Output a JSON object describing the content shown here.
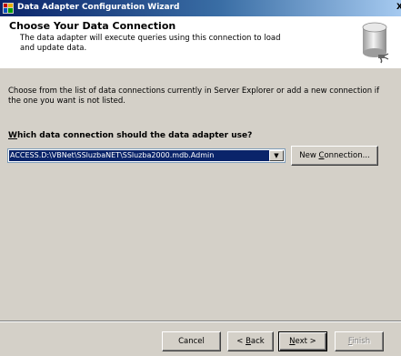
{
  "window": {
    "title": "Data Adapter Configuration Wizard",
    "close_glyph": "X"
  },
  "header": {
    "title": "Choose Your Data Connection",
    "subtitle": "The data adapter will execute queries using this connection to load and update data.",
    "icon": "database-icon"
  },
  "body": {
    "intro": "Choose from the list of data connections currently in Server Explorer or add a new connection if the one you want is not listed.",
    "question_prefix": "W",
    "question_rest": "hich data connection should the data adapter use?",
    "connection_selected": "ACCESS.D:\\VBNet\\SSluzbaNET\\SSluzba2000.mdb.Admin",
    "new_connection": {
      "pre": "New ",
      "acc": "C",
      "post": "onnection..."
    }
  },
  "footer": {
    "cancel": "Cancel",
    "back": {
      "pre": "< ",
      "acc": "B",
      "post": "ack"
    },
    "next": {
      "pre": "",
      "acc": "N",
      "post": "ext >"
    },
    "finish": {
      "pre": "",
      "acc": "F",
      "post": "inish"
    }
  },
  "colors": {
    "title_bar": "#0a246a",
    "face": "#d4d0c8",
    "selection": "#0a246a"
  }
}
